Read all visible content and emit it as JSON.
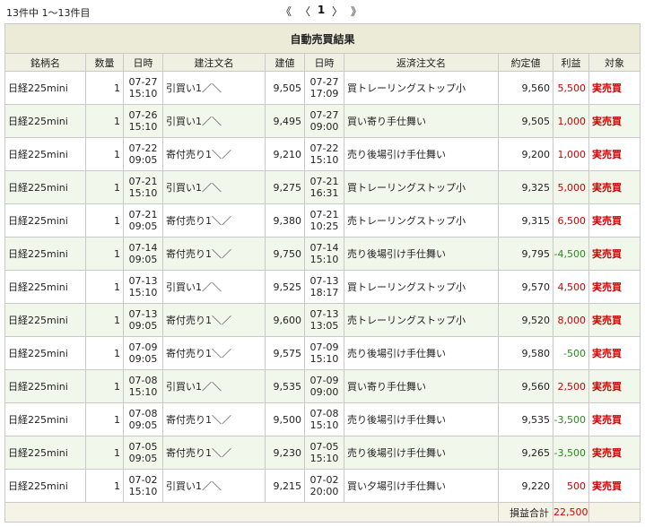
{
  "summary": {
    "count_text": "13件中 1〜13件目"
  },
  "pager": {
    "first": "《",
    "prev": "〈",
    "page": "1",
    "next": "〉",
    "last": "》"
  },
  "table": {
    "title": "自動売買結果",
    "headers": [
      "銘柄名",
      "数量",
      "日時",
      "建注文名",
      "建値",
      "日時",
      "返済注文名",
      "約定値",
      "利益",
      "対象"
    ],
    "rows": [
      {
        "symbol": "日経225mini",
        "qty": "1",
        "open_date": "07-27",
        "open_time": "15:10",
        "open_order": "引買い1／＼",
        "open_price": "9,505",
        "close_date": "07-27",
        "close_time": "17:09",
        "close_order": "買トレーリングストップ小",
        "exec_price": "9,560",
        "profit": "5,500",
        "profit_sign": "pos",
        "target": "実売買"
      },
      {
        "symbol": "日経225mini",
        "qty": "1",
        "open_date": "07-26",
        "open_time": "15:10",
        "open_order": "引買い1／＼",
        "open_price": "9,495",
        "close_date": "07-27",
        "close_time": "09:00",
        "close_order": "買い寄り手仕舞い",
        "exec_price": "9,505",
        "profit": "1,000",
        "profit_sign": "pos",
        "target": "実売買"
      },
      {
        "symbol": "日経225mini",
        "qty": "1",
        "open_date": "07-22",
        "open_time": "09:05",
        "open_order": "寄付売り1＼／",
        "open_price": "9,210",
        "close_date": "07-22",
        "close_time": "15:10",
        "close_order": "売り後場引け手仕舞い",
        "exec_price": "9,200",
        "profit": "1,000",
        "profit_sign": "pos",
        "target": "実売買"
      },
      {
        "symbol": "日経225mini",
        "qty": "1",
        "open_date": "07-21",
        "open_time": "15:10",
        "open_order": "引買い1／＼",
        "open_price": "9,275",
        "close_date": "07-21",
        "close_time": "16:31",
        "close_order": "買トレーリングストップ小",
        "exec_price": "9,325",
        "profit": "5,000",
        "profit_sign": "pos",
        "target": "実売買"
      },
      {
        "symbol": "日経225mini",
        "qty": "1",
        "open_date": "07-21",
        "open_time": "09:05",
        "open_order": "寄付売り1＼／",
        "open_price": "9,380",
        "close_date": "07-21",
        "close_time": "10:25",
        "close_order": "売トレーリングストップ小",
        "exec_price": "9,315",
        "profit": "6,500",
        "profit_sign": "pos",
        "target": "実売買"
      },
      {
        "symbol": "日経225mini",
        "qty": "1",
        "open_date": "07-14",
        "open_time": "09:05",
        "open_order": "寄付売り1＼／",
        "open_price": "9,750",
        "close_date": "07-14",
        "close_time": "15:10",
        "close_order": "売り後場引け手仕舞い",
        "exec_price": "9,795",
        "profit": "-4,500",
        "profit_sign": "neg",
        "target": "実売買"
      },
      {
        "symbol": "日経225mini",
        "qty": "1",
        "open_date": "07-13",
        "open_time": "15:10",
        "open_order": "引買い1／＼",
        "open_price": "9,525",
        "close_date": "07-13",
        "close_time": "18:17",
        "close_order": "買トレーリングストップ小",
        "exec_price": "9,570",
        "profit": "4,500",
        "profit_sign": "pos",
        "target": "実売買"
      },
      {
        "symbol": "日経225mini",
        "qty": "1",
        "open_date": "07-13",
        "open_time": "09:05",
        "open_order": "寄付売り1＼／",
        "open_price": "9,600",
        "close_date": "07-13",
        "close_time": "13:05",
        "close_order": "売トレーリングストップ小",
        "exec_price": "9,520",
        "profit": "8,000",
        "profit_sign": "pos",
        "target": "実売買"
      },
      {
        "symbol": "日経225mini",
        "qty": "1",
        "open_date": "07-09",
        "open_time": "09:05",
        "open_order": "寄付売り1＼／",
        "open_price": "9,575",
        "close_date": "07-09",
        "close_time": "15:10",
        "close_order": "売り後場引け手仕舞い",
        "exec_price": "9,580",
        "profit": "-500",
        "profit_sign": "neg",
        "target": "実売買"
      },
      {
        "symbol": "日経225mini",
        "qty": "1",
        "open_date": "07-08",
        "open_time": "15:10",
        "open_order": "引買い1／＼",
        "open_price": "9,535",
        "close_date": "07-09",
        "close_time": "09:00",
        "close_order": "買い寄り手仕舞い",
        "exec_price": "9,560",
        "profit": "2,500",
        "profit_sign": "pos",
        "target": "実売買"
      },
      {
        "symbol": "日経225mini",
        "qty": "1",
        "open_date": "07-08",
        "open_time": "09:05",
        "open_order": "寄付売り1＼／",
        "open_price": "9,500",
        "close_date": "07-08",
        "close_time": "15:10",
        "close_order": "売り後場引け手仕舞い",
        "exec_price": "9,535",
        "profit": "-3,500",
        "profit_sign": "neg",
        "target": "実売買"
      },
      {
        "symbol": "日経225mini",
        "qty": "1",
        "open_date": "07-05",
        "open_time": "09:05",
        "open_order": "寄付売り1＼／",
        "open_price": "9,230",
        "close_date": "07-05",
        "close_time": "15:10",
        "close_order": "売り後場引け手仕舞い",
        "exec_price": "9,265",
        "profit": "-3,500",
        "profit_sign": "neg",
        "target": "実売買"
      },
      {
        "symbol": "日経225mini",
        "qty": "1",
        "open_date": "07-02",
        "open_time": "15:10",
        "open_order": "引買い1／＼",
        "open_price": "9,215",
        "close_date": "07-02",
        "close_time": "20:00",
        "close_order": "買い夕場引け手仕舞い",
        "exec_price": "9,220",
        "profit": "500",
        "profit_sign": "pos",
        "target": "実売買"
      }
    ],
    "total_label": "損益合計",
    "total_value": "22,500"
  },
  "colors": {
    "profit_positive": "#d10000",
    "profit_negative": "#2a8a1d",
    "target_text": "#d10000"
  }
}
